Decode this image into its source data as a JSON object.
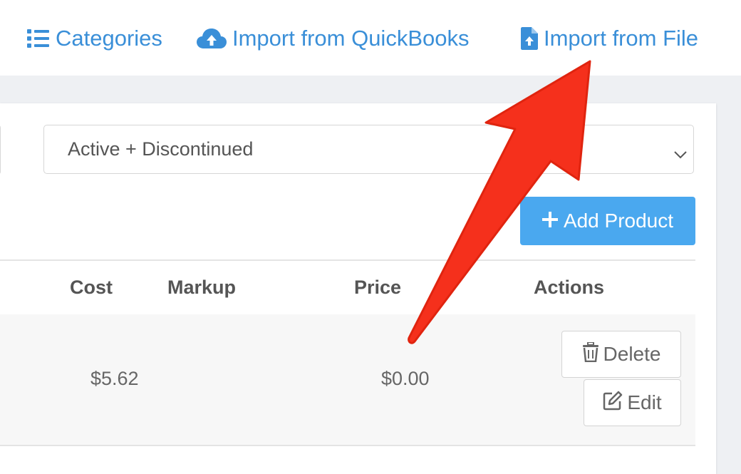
{
  "toolbar": {
    "categories_label": "Categories",
    "import_quickbooks_label": "Import from QuickBooks",
    "import_file_label": "Import from File",
    "link_color": "#3a8fd8"
  },
  "filter": {
    "status_value": "Active + Discontinued"
  },
  "actions": {
    "add_product_label": "Add Product",
    "add_button_color": "#4aa8ef"
  },
  "table": {
    "headers": [
      "Cost",
      "Markup",
      "Price",
      "Actions"
    ],
    "rows": [
      {
        "cost": "$5.62",
        "markup": "",
        "price": "$0.00",
        "delete_label": "Delete",
        "edit_label": "Edit"
      }
    ]
  },
  "annotation": {
    "arrow_color": "#f5301c",
    "points_to": "import-from-file-link"
  }
}
